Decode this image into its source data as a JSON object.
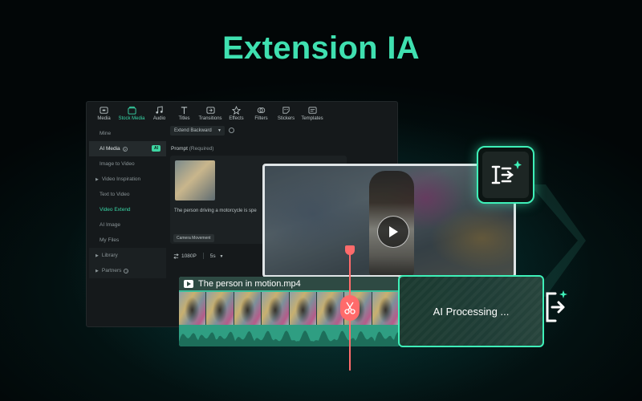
{
  "headline": "Extension IA",
  "toolbar": {
    "items": [
      {
        "label": "Media",
        "icon": "media-icon"
      },
      {
        "label": "Stock Media",
        "icon": "stock-media-icon",
        "active": true
      },
      {
        "label": "Audio",
        "icon": "audio-icon"
      },
      {
        "label": "Titles",
        "icon": "titles-icon"
      },
      {
        "label": "Transitions",
        "icon": "transitions-icon"
      },
      {
        "label": "Effects",
        "icon": "effects-icon"
      },
      {
        "label": "Filters",
        "icon": "filters-icon"
      },
      {
        "label": "Stickers",
        "icon": "stickers-icon"
      },
      {
        "label": "Templates",
        "icon": "templates-icon"
      }
    ]
  },
  "sidebar": {
    "items": [
      {
        "label": "Mine"
      },
      {
        "label": "AI Media",
        "badge": "AI"
      },
      {
        "label": "Image to Video"
      },
      {
        "label": "Video Inspiration"
      },
      {
        "label": "Text to Video"
      },
      {
        "label": "Video Extend"
      },
      {
        "label": "AI Image"
      },
      {
        "label": "My Files"
      },
      {
        "label": "Library"
      },
      {
        "label": "Partners"
      }
    ]
  },
  "panel": {
    "extend_select": "Extend Backward",
    "prompt_label": "Prompt",
    "prompt_required": "(Required)",
    "prompt_text": "The person driving a motorcycle is spe",
    "camera_chip": "Camera Movement",
    "resolution": "1080P",
    "duration": "5s"
  },
  "timeline": {
    "clip_title": "The person in motion.mp4",
    "frame_count": 8
  },
  "ai_processing": "AI Processing ...",
  "colors": {
    "accent": "#3fe0b0",
    "playhead": "#ff6b6b",
    "timeline_bg": "#3bbf9a"
  }
}
